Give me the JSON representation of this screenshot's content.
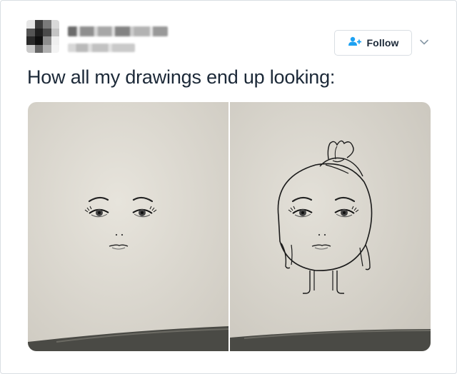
{
  "tweet": {
    "follow_label": "Follow",
    "text": "How all my drawings end up looking:"
  },
  "icons": {
    "follow": "add-user-icon",
    "menu": "chevron-down-icon"
  },
  "colors": {
    "brand_blue": "#1da1f2",
    "text": "#1c2938",
    "border": "#d9dee3",
    "paper": "#e3e0d8"
  },
  "media": {
    "images": [
      {
        "description": "face-only-drawing"
      },
      {
        "description": "full-character-drawing"
      }
    ]
  }
}
